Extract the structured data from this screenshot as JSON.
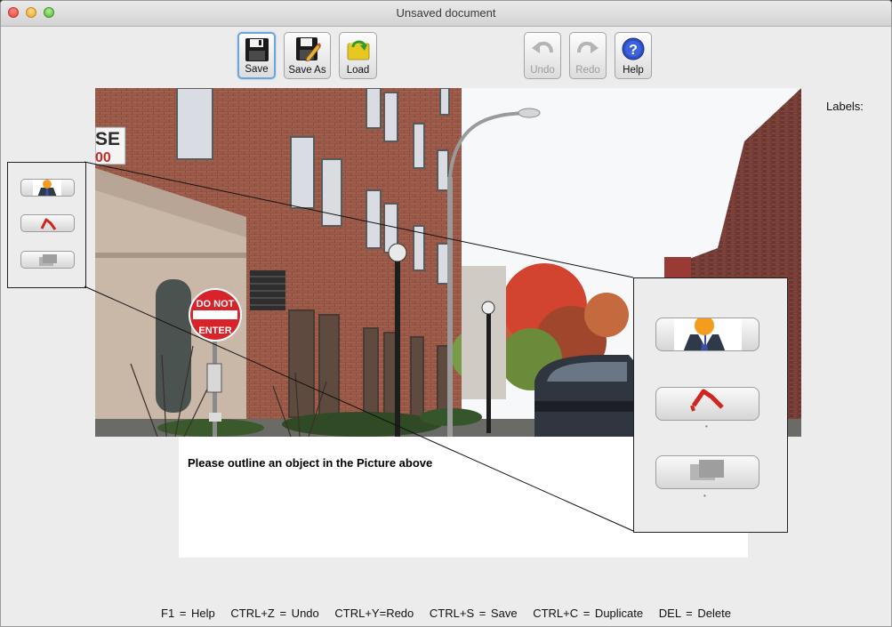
{
  "window": {
    "title": "Unsaved document"
  },
  "toolbar": {
    "save_label": "Save",
    "save_as_label": "Save As",
    "load_label": "Load",
    "undo_label": "Undo",
    "redo_label": "Redo",
    "help_label": "Help"
  },
  "labels_panel": {
    "heading": "Labels:"
  },
  "photo": {
    "building_sign": "SE\n00",
    "stop_sign_line1": "DO NOT",
    "stop_sign_line2": "ENTER"
  },
  "instruction": "Please outline an object in the Picture above",
  "tools": [
    {
      "name": "person-tool",
      "icon": "person-icon"
    },
    {
      "name": "outline-tool",
      "icon": "red-polyline-icon"
    },
    {
      "name": "stack-tool",
      "icon": "gray-stack-icon",
      "disabled": true
    }
  ],
  "shortcuts": [
    "F1 = Help",
    "CTRL+Z = Undo",
    "CTRL+Y=Redo",
    "CTRL+S = Save",
    "CTRL+C = Duplicate",
    "DEL = Delete"
  ],
  "colors": {
    "window_bg": "#ececec",
    "accent": "#6fa3da",
    "stop_sign": "#d8232a"
  }
}
